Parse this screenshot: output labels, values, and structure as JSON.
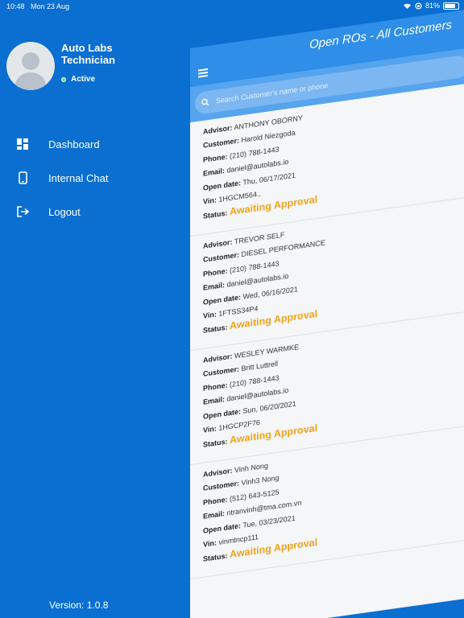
{
  "status_bar": {
    "time": "10:48",
    "date": "Mon 23 Aug",
    "battery": "81%",
    "battery_level": 0.81
  },
  "profile": {
    "name": "Auto Labs Technician",
    "status": "Active"
  },
  "menu": [
    {
      "label": "Dashboard",
      "icon": "dashboard-icon"
    },
    {
      "label": "Internal Chat",
      "icon": "tablet-icon"
    },
    {
      "label": "Logout",
      "icon": "logout-icon"
    }
  ],
  "version": "Version: 1.0.8",
  "header": {
    "title": "Open ROs - All Customers"
  },
  "search": {
    "placeholder": "Search Customer's name or phone"
  },
  "labels": {
    "advisor": "Advisor:",
    "customer": "Customer:",
    "phone": "Phone:",
    "email": "Email:",
    "open_date": "Open date:",
    "vin": "Vin:",
    "status": "Status:"
  },
  "orders": [
    {
      "advisor": "ANTHONY  OBORNY",
      "customer": "Harold  Niezgoda",
      "phone": "(210) 788-1443",
      "email": "daniel@autolabs.io",
      "open_date": "Thu, 06/17/2021",
      "vin": "1HGCM564..",
      "status": "Awaiting Approval"
    },
    {
      "advisor": "TREVOR  SELF",
      "customer": "DIESEL PERFORMANCE",
      "phone": "(210) 788-1443",
      "email": "daniel@autolabs.io",
      "open_date": "Wed, 06/16/2021",
      "vin": "1FTSS34P4",
      "status": "Awaiting Approval"
    },
    {
      "advisor": "WESLEY  WARMKE",
      "customer": "Britt  Luttrell",
      "phone": "(210) 788-1443",
      "email": "daniel@autolabs.io",
      "open_date": "Sun, 06/20/2021",
      "vin": "1HGCP2F76",
      "status": "Awaiting Approval"
    },
    {
      "advisor": "Vinh  Nong",
      "customer": "Vinh3  Nong",
      "phone": "(512) 643-5125",
      "email": "ntranvinh@tma.com.vn",
      "open_date": "Tue, 03/23/2021",
      "vin": "vinmtncp111",
      "status": "Awaiting Approval"
    }
  ],
  "colors": {
    "background": "#0a6fd0",
    "header": "#2e8ee8",
    "status_accent": "#f0a21a",
    "active": "#6fd66f"
  }
}
